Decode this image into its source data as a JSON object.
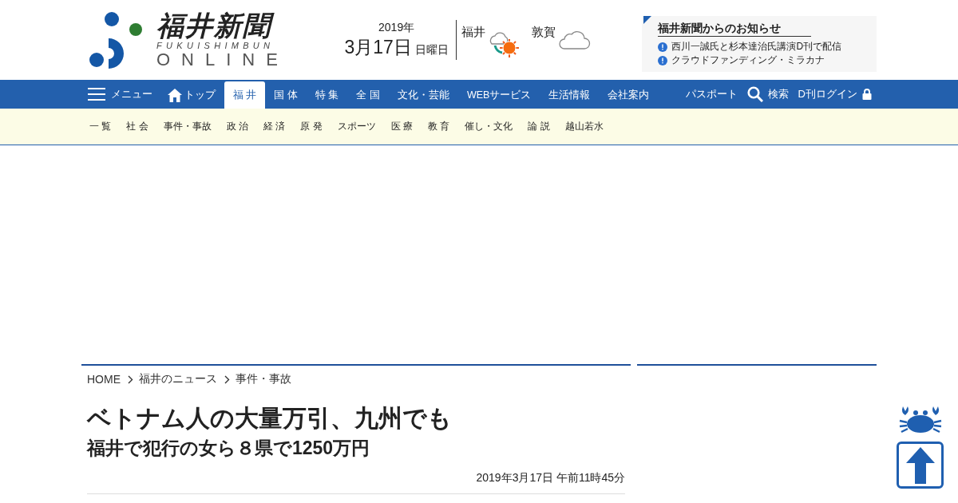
{
  "logo": {
    "title": "福井新聞",
    "subtitle": "FUKUISHIMBUN",
    "online": "ONLINE"
  },
  "date": {
    "year": "2019年",
    "day": "3月17日",
    "weekday": "日曜日"
  },
  "weather": [
    {
      "city": "福井",
      "kind": "cloudy-sunny"
    },
    {
      "city": "敦賀",
      "kind": "cloudy"
    }
  ],
  "notices": {
    "title": "福井新聞からのお知らせ",
    "items": [
      "西川一誠氏と杉本達治氏講演D刊で配信",
      "クラウドファンディング・ミラカナ"
    ]
  },
  "nav": {
    "menu": "メニュー",
    "items": [
      {
        "label": "トップ",
        "kind": "home",
        "selected": false
      },
      {
        "label": "福 井",
        "kind": "text",
        "selected": true
      },
      {
        "label": "国 体",
        "kind": "text",
        "selected": false
      },
      {
        "label": "特 集",
        "kind": "text",
        "selected": false
      },
      {
        "label": "全 国",
        "kind": "text",
        "selected": false
      },
      {
        "label": "文化・芸能",
        "kind": "text",
        "selected": false
      },
      {
        "label": "WEBサービス",
        "kind": "text",
        "selected": false
      },
      {
        "label": "生活情報",
        "kind": "text",
        "selected": false
      },
      {
        "label": "会社案内",
        "kind": "text",
        "selected": false
      }
    ],
    "passport": "パスポート",
    "search": "検索",
    "login": "D刊ログイン"
  },
  "subnav": [
    "一 覧",
    "社 会",
    "事件・事故",
    "政 治",
    "経 済",
    "原 発",
    "スポーツ",
    "医 療",
    "教 育",
    "催し・文化",
    "論 説",
    "越山若水"
  ],
  "breadcrumb": [
    "HOME",
    "福井のニュース",
    "事件・事故"
  ],
  "headline": "ベトナム人の大量万引、九州でも",
  "subheadline": "福井で犯行の女ら８県で1250万円",
  "timestamp": "2019年3月17日 午前11時45分"
}
